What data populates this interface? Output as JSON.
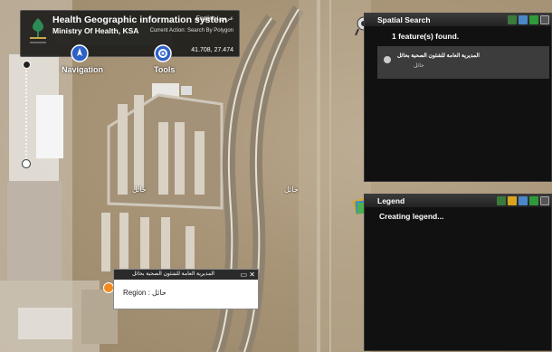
{
  "header": {
    "title": "Health Geographic information system",
    "subtitle": "Ministry Of Health, KSA",
    "lang_switch": "English | عربي",
    "current_action": "Current Action: Search By Polygon",
    "coords": "41.708, 27.474"
  },
  "nav": {
    "navigation_label": "Navigation",
    "tools_label": "Tools"
  },
  "map": {
    "label_left": "حائل",
    "label_right": "حائل"
  },
  "spatial_search": {
    "title": "Spatial Search",
    "found_text": "1 feature(s) found.",
    "result_name": "المديرية العامة للشئون الصحية بحائل",
    "result_city": "حائل"
  },
  "legend": {
    "title": "Legend",
    "status": "Creating legend..."
  },
  "popup": {
    "title": "المديرية العامة للشئون الصحية بحائل",
    "region_label": "Region :",
    "region_value": "حائل"
  },
  "colors": {
    "panel_bg": "#111111",
    "header_bg": "#141614",
    "marker": "#f28a1e",
    "nav_icon": "#2d62c8"
  }
}
